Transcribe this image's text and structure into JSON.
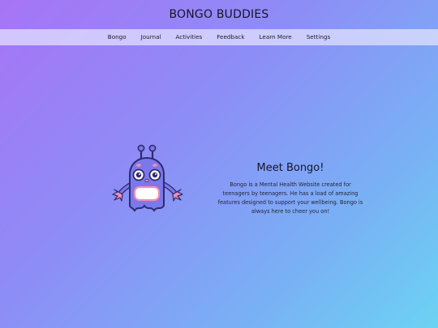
{
  "header": {
    "title": "BONGO BUDDIES"
  },
  "nav": {
    "items": [
      {
        "label": "Bongo"
      },
      {
        "label": "Journal"
      },
      {
        "label": "Activities"
      },
      {
        "label": "Feedback"
      },
      {
        "label": "Learn More"
      },
      {
        "label": "Settings"
      }
    ]
  },
  "hero": {
    "title": "Meet Bongo!",
    "description": "Bongo is a Mental Health Website created for teenagers by teenagers. He has a load of amazing features designed to support your wellbeing. Bongo is always here to cheer you on!",
    "mascot_icon": "bongo-mascot-icon"
  },
  "colors": {
    "gradient_start": "#a774f6",
    "gradient_end": "#6cd3f3",
    "nav_background": "#e4e4ff",
    "mascot_body": "#7b78ea",
    "mascot_outline": "#2e2a6e",
    "mascot_hands": "#f28fb0"
  }
}
